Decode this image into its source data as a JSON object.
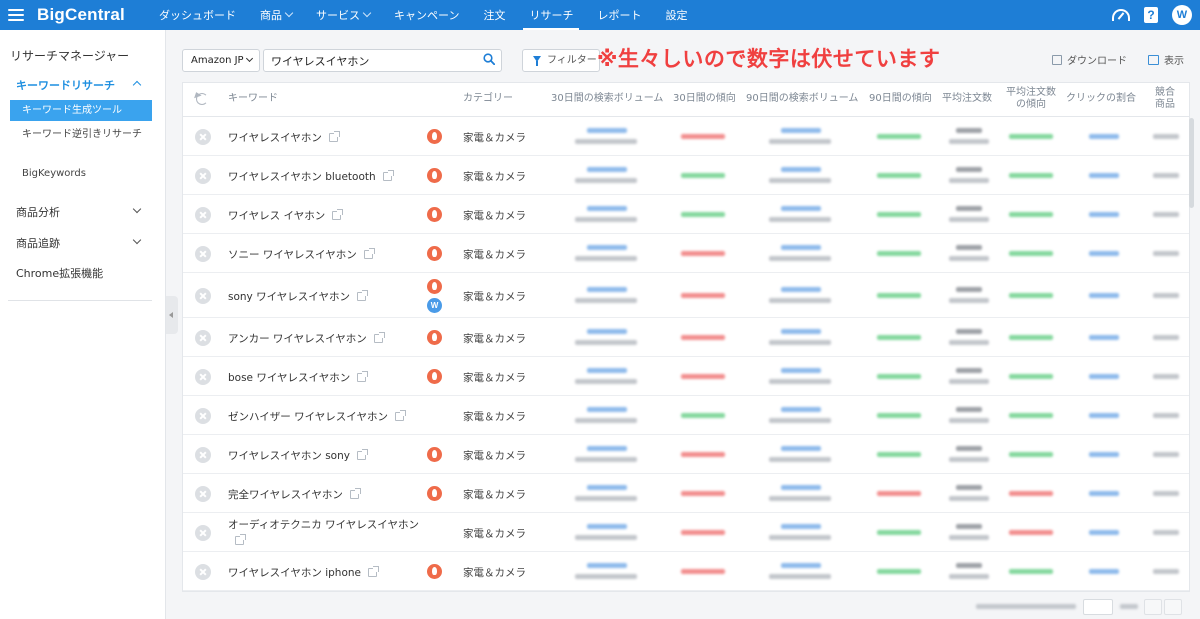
{
  "app": {
    "logo_a": "Big",
    "logo_b": "Central",
    "avatar_initial": "W",
    "help_label": "?"
  },
  "nav": [
    {
      "label": "ダッシュボード",
      "chevron": false,
      "active": false
    },
    {
      "label": "商品",
      "chevron": true,
      "active": false
    },
    {
      "label": "サービス",
      "chevron": true,
      "active": false
    },
    {
      "label": "キャンペーン",
      "chevron": false,
      "active": false
    },
    {
      "label": "注文",
      "chevron": false,
      "active": false
    },
    {
      "label": "リサーチ",
      "chevron": false,
      "active": true
    },
    {
      "label": "レポート",
      "chevron": false,
      "active": false
    },
    {
      "label": "設定",
      "chevron": false,
      "active": false
    }
  ],
  "sidebar": {
    "title": "リサーチマネージャー",
    "keyword_section": "キーワードリサーチ",
    "sub_items": [
      "キーワード生成ツール",
      "キーワード逆引きリサーチ",
      "BigKeywords"
    ],
    "product_analysis": "商品分析",
    "product_tracking": "商品追跡",
    "chrome_extension": "Chrome拡張機能"
  },
  "toolbar": {
    "marketplace": "Amazon JP",
    "search_value": "ワイヤレスイヤホン",
    "filter_label": "フィルター",
    "notice": "※生々しいので数字は伏せています",
    "download_label": "ダウンロード",
    "view_label": "表示"
  },
  "table": {
    "headers": {
      "keyword": "キーワード",
      "category": "カテゴリー",
      "vol30": "30日間の検索ボリューム",
      "trend30": "30日間の傾向",
      "vol90": "90日間の検索ボリューム",
      "trend90": "90日間の傾向",
      "avg_orders": "平均注文数",
      "avg_orders_trend_1": "平均注文数",
      "avg_orders_trend_2": "の傾向",
      "click_share": "クリックの割合",
      "competing_1": "競合",
      "competing_2": "商品"
    },
    "rows": [
      {
        "keyword": "ワイヤレスイヤホン",
        "category": "家電＆カメラ",
        "badges": [
          "fire"
        ],
        "t30": "red",
        "t90": "green",
        "tao": "green"
      },
      {
        "keyword": "ワイヤレスイヤホン bluetooth",
        "category": "家電＆カメラ",
        "badges": [
          "fire"
        ],
        "t30": "green",
        "t90": "green",
        "tao": "green"
      },
      {
        "keyword": "ワイヤレス イヤホン",
        "category": "家電＆カメラ",
        "badges": [
          "fire"
        ],
        "t30": "green",
        "t90": "green",
        "tao": "green"
      },
      {
        "keyword": "ソニー ワイヤレスイヤホン",
        "category": "家電＆カメラ",
        "badges": [
          "fire"
        ],
        "t30": "red",
        "t90": "green",
        "tao": "green"
      },
      {
        "keyword": "sony ワイヤレスイヤホン",
        "category": "家電＆カメラ",
        "badges": [
          "fire",
          "w"
        ],
        "t30": "red",
        "t90": "green",
        "tao": "green"
      },
      {
        "keyword": "アンカー ワイヤレスイヤホン",
        "category": "家電＆カメラ",
        "badges": [
          "fire"
        ],
        "t30": "red",
        "t90": "green",
        "tao": "green"
      },
      {
        "keyword": "bose ワイヤレスイヤホン",
        "category": "家電＆カメラ",
        "badges": [
          "fire"
        ],
        "t30": "red",
        "t90": "green",
        "tao": "green"
      },
      {
        "keyword": "ゼンハイザー ワイヤレスイヤホン",
        "category": "家電＆カメラ",
        "badges": [],
        "t30": "green",
        "t90": "green",
        "tao": "green"
      },
      {
        "keyword": "ワイヤレスイヤホン sony",
        "category": "家電＆カメラ",
        "badges": [
          "fire"
        ],
        "t30": "red",
        "t90": "green",
        "tao": "green"
      },
      {
        "keyword": "完全ワイヤレスイヤホン",
        "category": "家電＆カメラ",
        "badges": [
          "fire"
        ],
        "t30": "red",
        "t90": "red",
        "tao": "red"
      },
      {
        "keyword": "オーディオテクニカ ワイヤレスイヤホン",
        "category": "家電＆カメラ",
        "badges": [],
        "t30": "red",
        "t90": "green",
        "tao": "red"
      },
      {
        "keyword": "ワイヤレスイヤホン iphone",
        "category": "家電＆カメラ",
        "badges": [
          "fire"
        ],
        "t30": "red",
        "t90": "green",
        "tao": "green"
      }
    ]
  },
  "colors": {
    "topbar": "#1e7ed6",
    "accent": "#1e8fe0",
    "fire": "#ef6b4a",
    "notice": "#f04040"
  }
}
